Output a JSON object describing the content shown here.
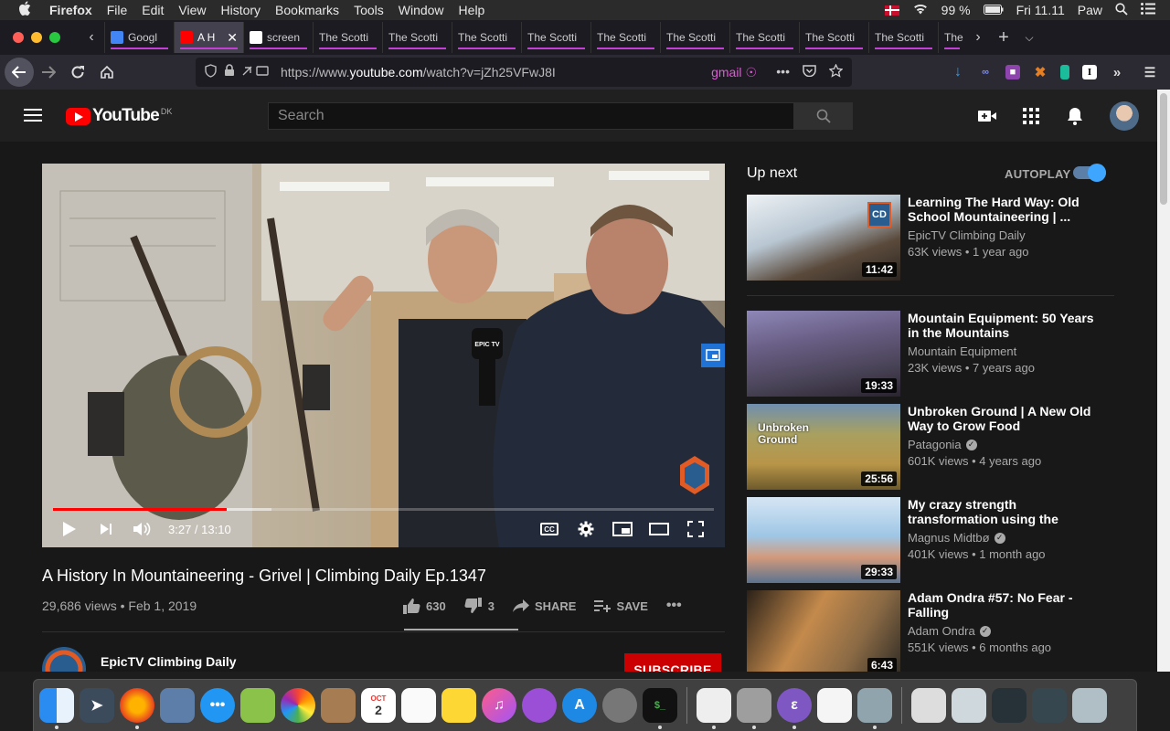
{
  "menubar": {
    "apple": "",
    "app": "Firefox",
    "items": [
      "File",
      "Edit",
      "View",
      "History",
      "Bookmarks",
      "Tools",
      "Window",
      "Help"
    ],
    "battery": "99 %",
    "datetime": "Fri 11.11",
    "user": "Paw"
  },
  "tabs": [
    {
      "title": "Googl",
      "fav_color": "#4285f4"
    },
    {
      "title": "A H",
      "fav_color": "#ff0000",
      "active": true
    },
    {
      "title": "screen",
      "fav_color": "#ffffff"
    },
    {
      "title": "The Scotti",
      "fav_color": ""
    },
    {
      "title": "The Scotti",
      "fav_color": ""
    },
    {
      "title": "The Scotti",
      "fav_color": ""
    },
    {
      "title": "The Scotti",
      "fav_color": ""
    },
    {
      "title": "The Scotti",
      "fav_color": ""
    },
    {
      "title": "The Scotti",
      "fav_color": ""
    },
    {
      "title": "The Scotti",
      "fav_color": ""
    },
    {
      "title": "The Scotti",
      "fav_color": ""
    },
    {
      "title": "The Scotti",
      "fav_color": ""
    },
    {
      "title": "The",
      "fav_color": ""
    }
  ],
  "toolbar": {
    "url_prefix": "https://www.",
    "url_host": "youtube.com",
    "url_path": "/watch?v=jZh25VFwJ8I",
    "gmail": "gmail"
  },
  "youtube": {
    "logo_text": "YouTube",
    "country": "DK",
    "search_placeholder": "Search",
    "video": {
      "title": "A History In Mountaineering - Grivel | Climbing Daily Ep.1347",
      "views_date": "29,686 views • Feb 1, 2019",
      "time": "3:27 / 13:10",
      "played_fraction": 0.263,
      "loaded_fraction": 0.33,
      "likes": "630",
      "dislikes": "3",
      "share": "SHARE",
      "save": "SAVE",
      "mic_label": "EPIC TV",
      "cc_label": "CC"
    },
    "channel": {
      "name": "EpicTV Climbing Daily",
      "subscribe": "SUBSCRIBE"
    },
    "upnext": {
      "title": "Up next",
      "autoplay": "AUTOPLAY",
      "items": [
        {
          "title": "Learning The Hard Way: Old School Mountaineering | ...",
          "channel": "EpicTV Climbing Daily",
          "verified": false,
          "meta": "63K views • 1 year ago",
          "duration": "11:42",
          "badge": "CD"
        },
        {
          "title": "Mountain Equipment: 50 Years in the Mountains",
          "channel": "Mountain Equipment",
          "verified": false,
          "meta": "23K views • 7 years ago",
          "duration": "19:33",
          "badge": ""
        },
        {
          "title": "Unbroken Ground | A New Old Way to Grow Food",
          "channel": "Patagonia",
          "verified": true,
          "meta": "601K views • 4 years ago",
          "duration": "25:56",
          "badge": "Unbroken Ground"
        },
        {
          "title": "My crazy strength transformation using the Wim...",
          "channel": "Magnus Midtbø",
          "verified": true,
          "meta": "401K views • 1 month ago",
          "duration": "29:33",
          "badge": ""
        },
        {
          "title": "Adam Ondra #57: No Fear - Falling",
          "channel": "Adam Ondra",
          "verified": true,
          "meta": "551K views • 6 months ago",
          "duration": "6:43",
          "badge": ""
        }
      ]
    }
  },
  "dock": {
    "calendar_month": "OCT",
    "calendar_day": "2"
  }
}
